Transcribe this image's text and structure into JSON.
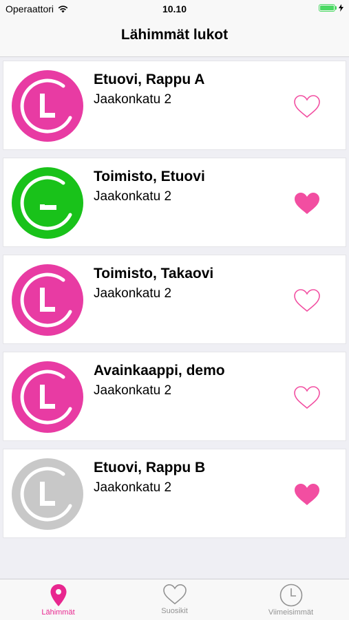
{
  "status_bar": {
    "carrier": "Operaattori",
    "time": "10.10"
  },
  "nav": {
    "title": "Lähimmät lukot"
  },
  "colors": {
    "accent": "#e8278f",
    "heart": "#f24ea1",
    "lock_pink": "#e83ba3",
    "lock_green": "#19c21a",
    "lock_gray": "#c8c8c8"
  },
  "locks": [
    {
      "name": "Etuovi, Rappu A",
      "address": "Jaakonkatu 2",
      "icon_color": "pink",
      "state": "locked",
      "favorite": false
    },
    {
      "name": "Toimisto, Etuovi",
      "address": "Jaakonkatu 2",
      "icon_color": "green",
      "state": "unlocked",
      "favorite": true
    },
    {
      "name": "Toimisto, Takaovi",
      "address": "Jaakonkatu 2",
      "icon_color": "pink",
      "state": "locked",
      "favorite": false
    },
    {
      "name": "Avainkaappi, demo",
      "address": "Jaakonkatu 2",
      "icon_color": "pink",
      "state": "locked",
      "favorite": false
    },
    {
      "name": "Etuovi, Rappu B",
      "address": "Jaakonkatu 2",
      "icon_color": "gray",
      "state": "locked",
      "favorite": true
    }
  ],
  "tabs": [
    {
      "label": "Lähimmät",
      "icon": "location-pin-icon",
      "active": true
    },
    {
      "label": "Suosikit",
      "icon": "heart-icon",
      "active": false
    },
    {
      "label": "Viimeisimmät",
      "icon": "clock-icon",
      "active": false
    }
  ]
}
